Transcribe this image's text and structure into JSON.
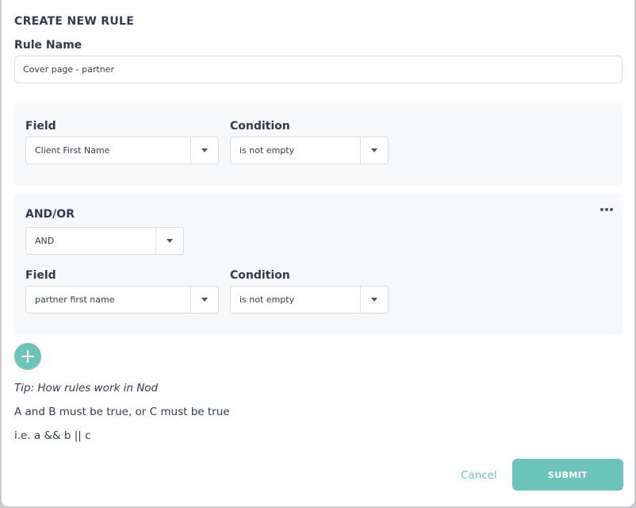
{
  "modal": {
    "title": "CREATE NEW RULE"
  },
  "rule_name": {
    "label": "Rule Name",
    "value": "Cover page - partner"
  },
  "condition_1": {
    "field_label": "Field",
    "field_value": "Client First Name",
    "condition_label": "Condition",
    "condition_value": "is not empty"
  },
  "condition_2": {
    "andor_label": "AND/OR",
    "andor_value": "AND",
    "field_label": "Field",
    "field_value": "partner first name",
    "condition_label": "Condition",
    "condition_value": "is not empty"
  },
  "tip": {
    "heading": "Tip: How rules work in Nod",
    "line1": "A and B must be true, or C must be true",
    "line2": "i.e. a && b || c"
  },
  "actions": {
    "cancel": "Cancel",
    "submit": "SUBMIT"
  },
  "colors": {
    "accent": "#6dc4ba",
    "text": "#2f3c4f",
    "panel_bg": "#f7f8fa"
  },
  "icons": {
    "dropdown": "chevron-down-icon",
    "more": "more-horizontal-icon",
    "add": "plus-icon"
  }
}
